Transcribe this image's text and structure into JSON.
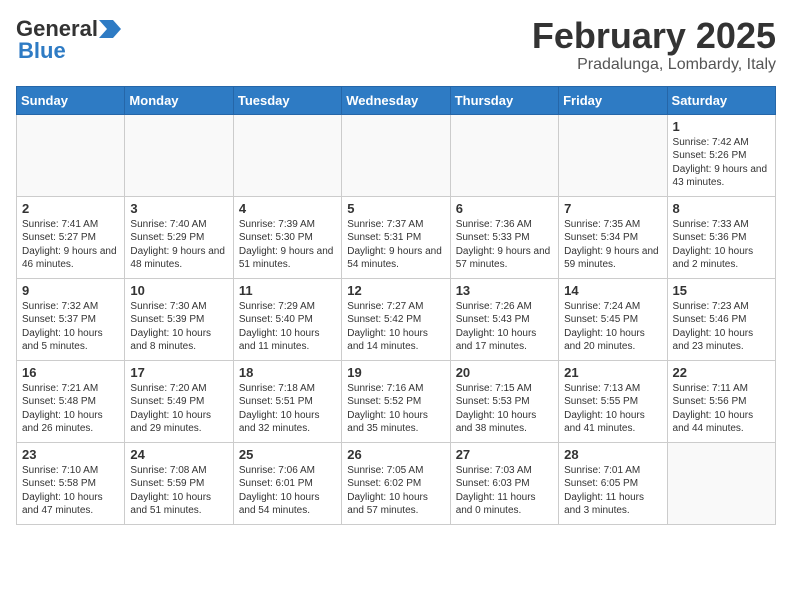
{
  "logo": {
    "general": "General",
    "blue": "Blue"
  },
  "header": {
    "month": "February 2025",
    "location": "Pradalunga, Lombardy, Italy"
  },
  "weekdays": [
    "Sunday",
    "Monday",
    "Tuesday",
    "Wednesday",
    "Thursday",
    "Friday",
    "Saturday"
  ],
  "weeks": [
    [
      {
        "day": "",
        "info": ""
      },
      {
        "day": "",
        "info": ""
      },
      {
        "day": "",
        "info": ""
      },
      {
        "day": "",
        "info": ""
      },
      {
        "day": "",
        "info": ""
      },
      {
        "day": "",
        "info": ""
      },
      {
        "day": "1",
        "info": "Sunrise: 7:42 AM\nSunset: 5:26 PM\nDaylight: 9 hours and 43 minutes."
      }
    ],
    [
      {
        "day": "2",
        "info": "Sunrise: 7:41 AM\nSunset: 5:27 PM\nDaylight: 9 hours and 46 minutes."
      },
      {
        "day": "3",
        "info": "Sunrise: 7:40 AM\nSunset: 5:29 PM\nDaylight: 9 hours and 48 minutes."
      },
      {
        "day": "4",
        "info": "Sunrise: 7:39 AM\nSunset: 5:30 PM\nDaylight: 9 hours and 51 minutes."
      },
      {
        "day": "5",
        "info": "Sunrise: 7:37 AM\nSunset: 5:31 PM\nDaylight: 9 hours and 54 minutes."
      },
      {
        "day": "6",
        "info": "Sunrise: 7:36 AM\nSunset: 5:33 PM\nDaylight: 9 hours and 57 minutes."
      },
      {
        "day": "7",
        "info": "Sunrise: 7:35 AM\nSunset: 5:34 PM\nDaylight: 9 hours and 59 minutes."
      },
      {
        "day": "8",
        "info": "Sunrise: 7:33 AM\nSunset: 5:36 PM\nDaylight: 10 hours and 2 minutes."
      }
    ],
    [
      {
        "day": "9",
        "info": "Sunrise: 7:32 AM\nSunset: 5:37 PM\nDaylight: 10 hours and 5 minutes."
      },
      {
        "day": "10",
        "info": "Sunrise: 7:30 AM\nSunset: 5:39 PM\nDaylight: 10 hours and 8 minutes."
      },
      {
        "day": "11",
        "info": "Sunrise: 7:29 AM\nSunset: 5:40 PM\nDaylight: 10 hours and 11 minutes."
      },
      {
        "day": "12",
        "info": "Sunrise: 7:27 AM\nSunset: 5:42 PM\nDaylight: 10 hours and 14 minutes."
      },
      {
        "day": "13",
        "info": "Sunrise: 7:26 AM\nSunset: 5:43 PM\nDaylight: 10 hours and 17 minutes."
      },
      {
        "day": "14",
        "info": "Sunrise: 7:24 AM\nSunset: 5:45 PM\nDaylight: 10 hours and 20 minutes."
      },
      {
        "day": "15",
        "info": "Sunrise: 7:23 AM\nSunset: 5:46 PM\nDaylight: 10 hours and 23 minutes."
      }
    ],
    [
      {
        "day": "16",
        "info": "Sunrise: 7:21 AM\nSunset: 5:48 PM\nDaylight: 10 hours and 26 minutes."
      },
      {
        "day": "17",
        "info": "Sunrise: 7:20 AM\nSunset: 5:49 PM\nDaylight: 10 hours and 29 minutes."
      },
      {
        "day": "18",
        "info": "Sunrise: 7:18 AM\nSunset: 5:51 PM\nDaylight: 10 hours and 32 minutes."
      },
      {
        "day": "19",
        "info": "Sunrise: 7:16 AM\nSunset: 5:52 PM\nDaylight: 10 hours and 35 minutes."
      },
      {
        "day": "20",
        "info": "Sunrise: 7:15 AM\nSunset: 5:53 PM\nDaylight: 10 hours and 38 minutes."
      },
      {
        "day": "21",
        "info": "Sunrise: 7:13 AM\nSunset: 5:55 PM\nDaylight: 10 hours and 41 minutes."
      },
      {
        "day": "22",
        "info": "Sunrise: 7:11 AM\nSunset: 5:56 PM\nDaylight: 10 hours and 44 minutes."
      }
    ],
    [
      {
        "day": "23",
        "info": "Sunrise: 7:10 AM\nSunset: 5:58 PM\nDaylight: 10 hours and 47 minutes."
      },
      {
        "day": "24",
        "info": "Sunrise: 7:08 AM\nSunset: 5:59 PM\nDaylight: 10 hours and 51 minutes."
      },
      {
        "day": "25",
        "info": "Sunrise: 7:06 AM\nSunset: 6:01 PM\nDaylight: 10 hours and 54 minutes."
      },
      {
        "day": "26",
        "info": "Sunrise: 7:05 AM\nSunset: 6:02 PM\nDaylight: 10 hours and 57 minutes."
      },
      {
        "day": "27",
        "info": "Sunrise: 7:03 AM\nSunset: 6:03 PM\nDaylight: 11 hours and 0 minutes."
      },
      {
        "day": "28",
        "info": "Sunrise: 7:01 AM\nSunset: 6:05 PM\nDaylight: 11 hours and 3 minutes."
      },
      {
        "day": "",
        "info": ""
      }
    ]
  ]
}
